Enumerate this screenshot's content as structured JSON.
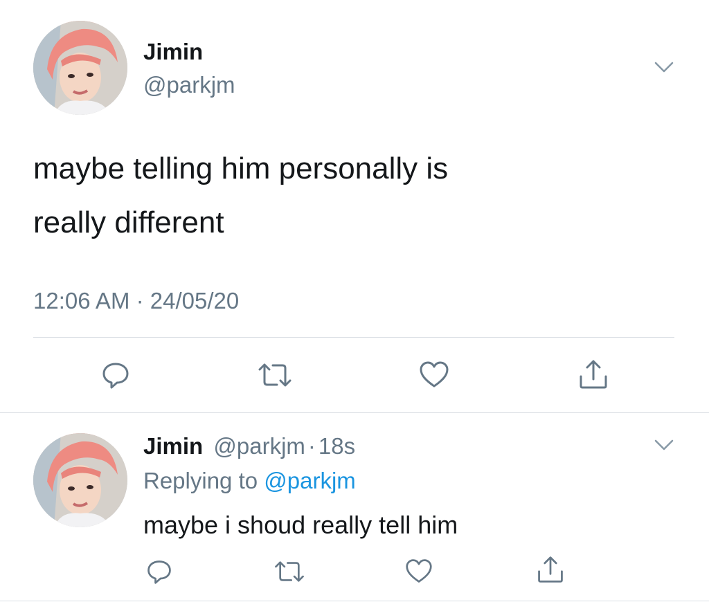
{
  "main_tweet": {
    "name": "Jimin",
    "handle": "@parkjm",
    "text_line1": "maybe telling him personally is",
    "text_line2": "really different",
    "timestamp": "12:06 AM · 24/05/20"
  },
  "reply_tweet": {
    "name": "Jimin",
    "handle": "@parkjm",
    "separator": "·",
    "age": "18s",
    "replying_prefix": "Replying to",
    "replying_handle": "@parkjm",
    "text": "maybe i shoud really tell him"
  },
  "icons": {
    "reply": "reply-icon",
    "retweet": "retweet-icon",
    "like": "like-icon",
    "share": "share-icon",
    "more": "chevron-down-icon"
  },
  "colors": {
    "text": "#14171a",
    "muted": "#657786",
    "link": "#1b95e0",
    "divider": "#d9dee3"
  }
}
